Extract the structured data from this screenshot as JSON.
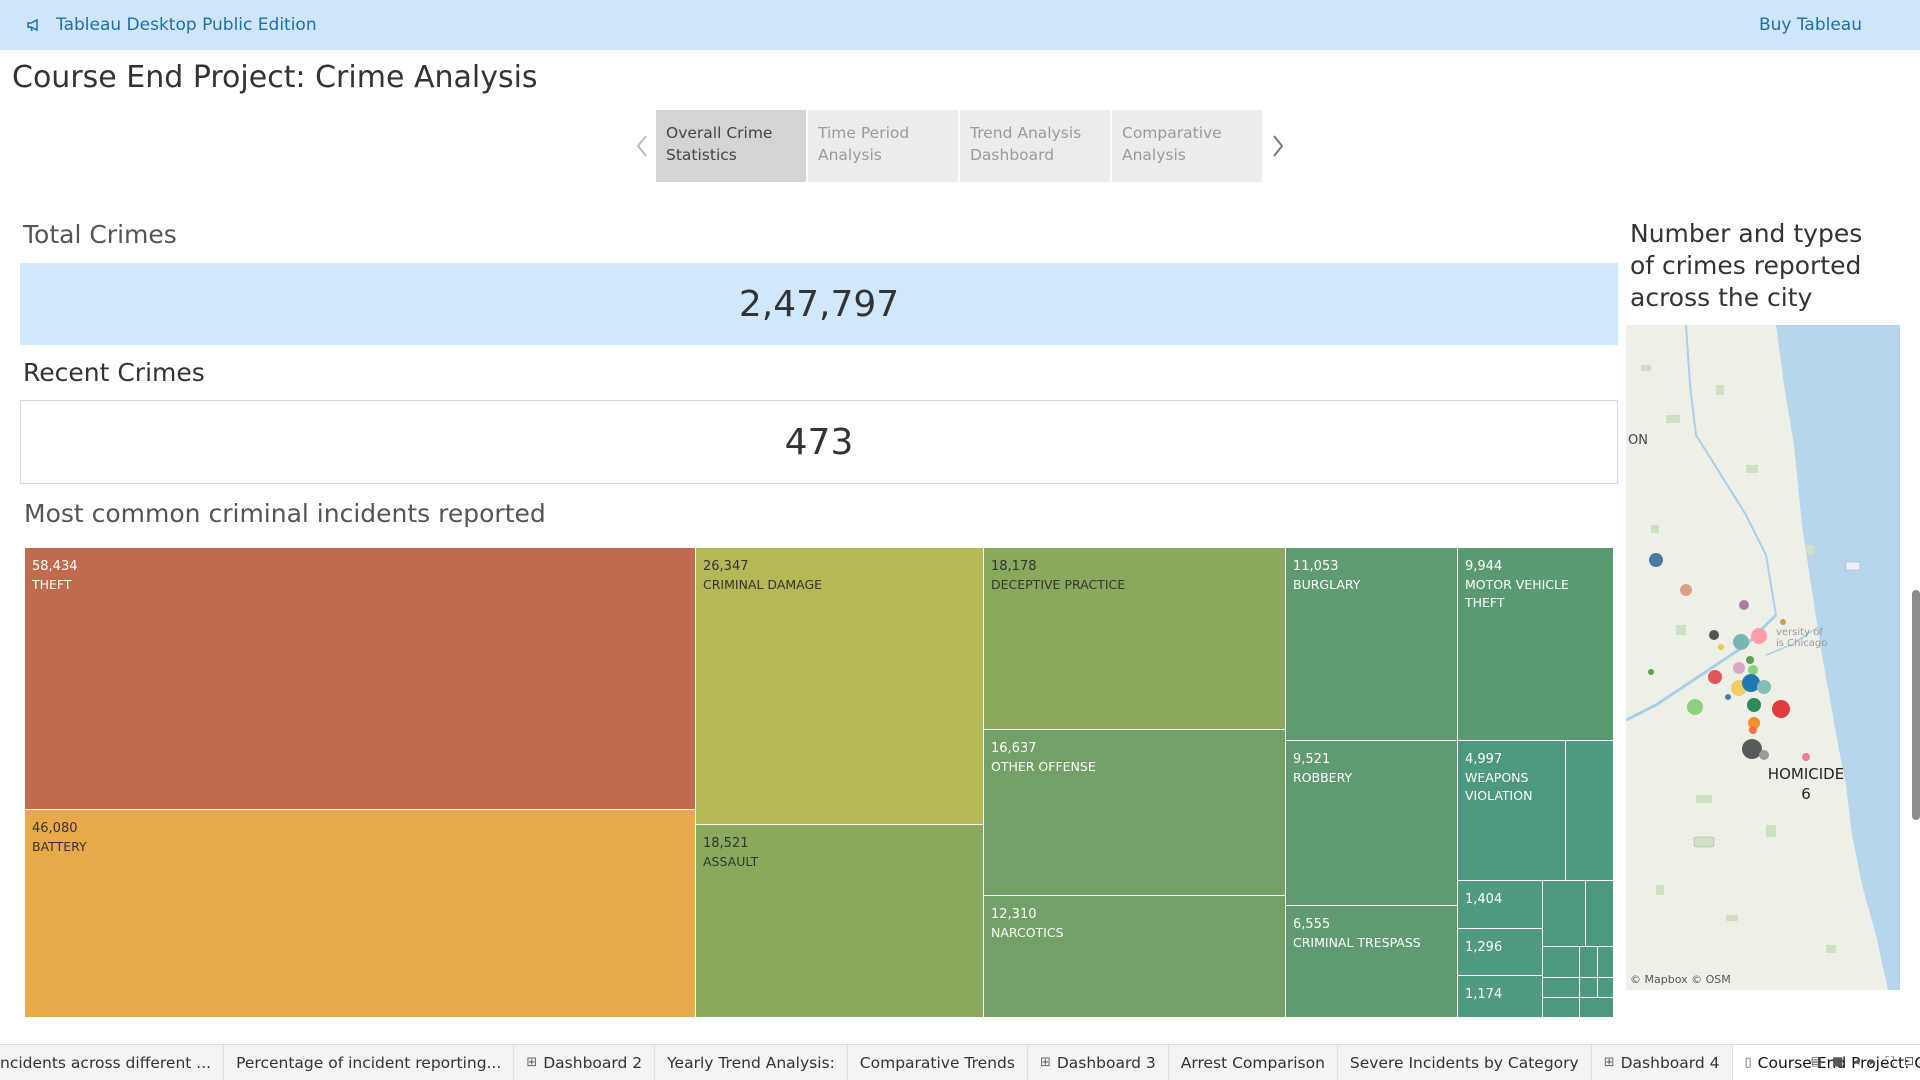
{
  "topbar": {
    "app_title": "Tableau Desktop Public Edition",
    "buy_label": "Buy Tableau",
    "icon": "megaphone-icon"
  },
  "story": {
    "title": "Course End Project: Crime Analysis",
    "points": [
      {
        "line1": "Overall Crime",
        "line2": "Statistics"
      },
      {
        "line1": "Time Period",
        "line2": "Analysis"
      },
      {
        "line1": "Trend Analysis",
        "line2": "Dashboard"
      },
      {
        "line1": "Comparative",
        "line2": "Analysis"
      }
    ],
    "active_point": 0
  },
  "kpis": {
    "total_title": "Total Crimes",
    "total_value": "2,47,797",
    "recent_title": "Recent Crimes",
    "recent_value": "473"
  },
  "treemap": {
    "title": "Most common criminal incidents reported",
    "cells": [
      {
        "value": "58,434",
        "label": "THEFT"
      },
      {
        "value": "46,080",
        "label": "BATTERY"
      },
      {
        "value": "26,347",
        "label": "CRIMINAL DAMAGE"
      },
      {
        "value": "18,521",
        "label": "ASSAULT"
      },
      {
        "value": "18,178",
        "label": "DECEPTIVE PRACTICE"
      },
      {
        "value": "16,637",
        "label": "OTHER OFFENSE"
      },
      {
        "value": "12,310",
        "label": "NARCOTICS"
      },
      {
        "value": "11,053",
        "label": "BURGLARY"
      },
      {
        "value": "9,521",
        "label": "ROBBERY"
      },
      {
        "value": "6,555",
        "label": "CRIMINAL TRESPASS"
      },
      {
        "value": "9,944",
        "label": "MOTOR VEHICLE THEFT"
      },
      {
        "value": "4,997",
        "label": "WEAPONS VIOLATION"
      },
      {
        "value": "1,404",
        "label": ""
      },
      {
        "value": "1,296",
        "label": ""
      },
      {
        "value": "1,174",
        "label": ""
      }
    ],
    "colors": {
      "theft": "#c06b4e",
      "battery": "#e8a94b",
      "criminal_damage": "#b4b955",
      "assault": "#8aa95c",
      "deceptive": "#8aa95c",
      "other": "#72a066",
      "narcotics": "#72a066",
      "burglary": "#5f9a70",
      "robbery": "#5f9a70",
      "trespass": "#5f9a70",
      "mvt": "#5a9a72",
      "weapons": "#4d9880",
      "small": "#4f9a80"
    }
  },
  "map": {
    "title": "Number and types of crimes reported across the city",
    "edge_label": "ON",
    "tooltip_type": "HOMICIDE",
    "tooltip_value": "6",
    "university_label": "versity of\nis Chicago",
    "credit": "© Mapbox © OSM",
    "water_color": "#b7d6ec"
  },
  "tabs": [
    {
      "label": "ncidents across different ...",
      "icon": ""
    },
    {
      "label": "Percentage of incident reporting...",
      "icon": ""
    },
    {
      "label": "Dashboard 2",
      "icon": "dashboard-grid-icon"
    },
    {
      "label": "Yearly Trend Analysis:",
      "icon": ""
    },
    {
      "label": "Comparative Trends",
      "icon": ""
    },
    {
      "label": "Dashboard 3",
      "icon": "dashboard-grid-icon"
    },
    {
      "label": "Arrest Comparison",
      "icon": ""
    },
    {
      "label": "Severe Incidents by Category",
      "icon": ""
    },
    {
      "label": "Dashboard 4",
      "icon": "dashboard-grid-icon"
    },
    {
      "label": "Course End Project: Crime A...",
      "icon": "story-book-icon"
    }
  ]
}
